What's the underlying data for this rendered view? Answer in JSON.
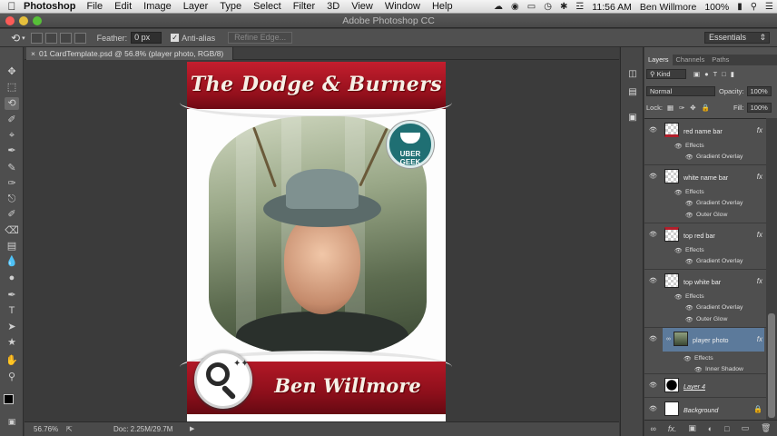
{
  "menubar": {
    "app_name": "Photoshop",
    "items": [
      "File",
      "Edit",
      "Image",
      "Layer",
      "Type",
      "Select",
      "Filter",
      "3D",
      "View",
      "Window",
      "Help"
    ],
    "clock": "11:56 AM",
    "user": "Ben Willmore",
    "battery": "100%"
  },
  "window": {
    "title": "Adobe Photoshop CC"
  },
  "options": {
    "feather_label": "Feather:",
    "feather_value": "0 px",
    "antialias_label": "Anti-alias",
    "refine_edge": "Refine Edge...",
    "workspace": "Essentials"
  },
  "document": {
    "tab": "01 CardTemplate.psd @ 56.8% (player photo, RGB/8)",
    "zoom": "56.76%",
    "doc_info": "Doc: 2.25M/29.7M"
  },
  "card": {
    "team": "The Dodge & Burners",
    "player": "Ben Willmore",
    "badge": "UBER GEEK"
  },
  "panel": {
    "tabs": [
      "Layers",
      "Channels",
      "Paths"
    ],
    "kind": "Kind",
    "blend_mode": "Normal",
    "opacity_label": "Opacity:",
    "opacity": "100%",
    "lock_label": "Lock:",
    "fill_label": "Fill:",
    "fill": "100%",
    "layers": [
      {
        "name": "red name bar",
        "effects_label": "Effects",
        "effects": [
          "Gradient Overlay"
        ]
      },
      {
        "name": "white name bar",
        "effects_label": "Effects",
        "effects": [
          "Gradient Overlay",
          "Outer Glow"
        ]
      },
      {
        "name": "top red bar",
        "effects_label": "Effects",
        "effects": [
          "Gradient Overlay"
        ]
      },
      {
        "name": "top white bar",
        "effects_label": "Effects",
        "effects": [
          "Gradient Overlay",
          "Outer Glow"
        ]
      },
      {
        "name": "player photo",
        "effects_label": "Effects",
        "effects": [
          "Inner Shadow"
        ]
      },
      {
        "name": "Layer 4"
      },
      {
        "name": "Background"
      }
    ]
  }
}
